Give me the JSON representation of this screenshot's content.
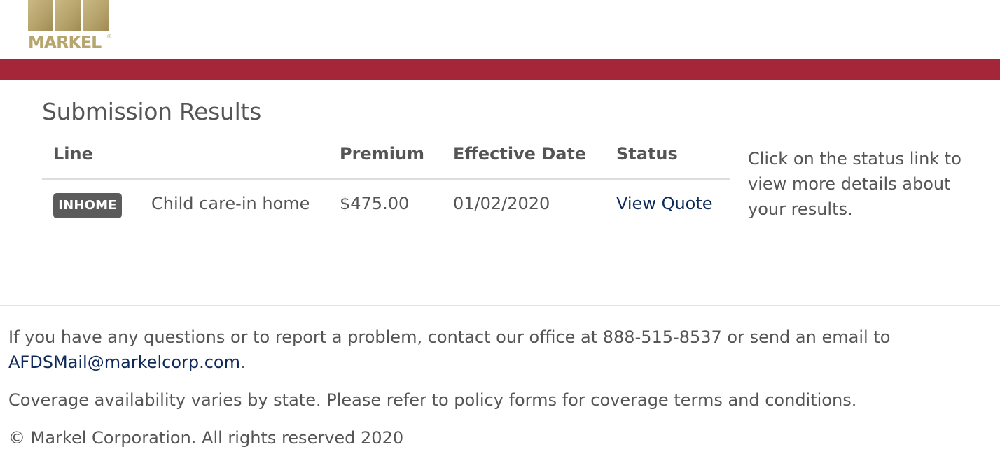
{
  "header": {
    "logo_text": "MARKEL",
    "logo_mark": "®",
    "logo_color": "#b7a56e",
    "bar_color": "#a62639"
  },
  "main": {
    "title": "Submission Results",
    "columns": {
      "line": "Line",
      "premium": "Premium",
      "effective_date": "Effective Date",
      "status": "Status"
    },
    "rows": [
      {
        "badge": "INHOME",
        "description": "Child care-in home",
        "premium": "$475.00",
        "effective_date": "01/02/2020",
        "status_link": "View Quote"
      }
    ],
    "help": "Click on the status link to view more details about your results."
  },
  "footer": {
    "contact_text": "If you have any questions or to report a problem, contact our office at 888-515-8537 or send an email to",
    "email": "AFDSMail@markelcorp.com",
    "email_suffix": ".",
    "coverage_note": "Coverage availability varies by state. Please refer to policy forms for coverage terms and conditions.",
    "copyright": "© Markel Corporation. All rights reserved 2020"
  }
}
